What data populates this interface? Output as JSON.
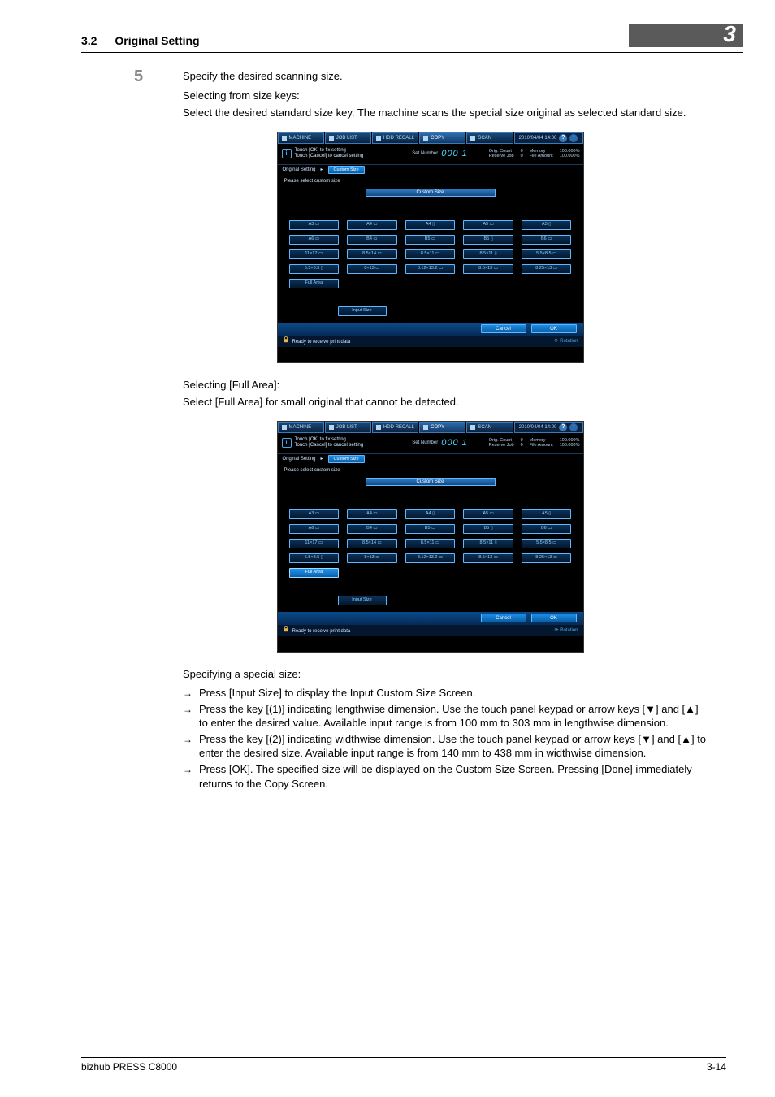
{
  "header": {
    "section_num": "3.2",
    "section_title": "Original Setting",
    "chapter": "3"
  },
  "step": {
    "num": "5",
    "text": "Specify the desired scanning size.",
    "sizekeys_heading": "Selecting from size keys:",
    "sizekeys_body": "Select the desired standard size key. The machine scans the special size original as selected standard size.",
    "fullarea_heading": "Selecting [Full Area]:",
    "fullarea_body": "Select [Full Area] for small original that cannot be detected.",
    "special_heading": "Specifying a special size:",
    "bullets": [
      "Press [Input Size] to display the Input Custom Size Screen.",
      "Press the key [(1)] indicating lengthwise dimension. Use the touch panel keypad or arrow keys [▼] and [▲] to enter the desired value. Available input range is from 100 mm to 303 mm in lengthwise dimension.",
      "Press the key [(2)] indicating widthwise dimension. Use the touch panel keypad or arrow keys [▼] and [▲] to enter the desired size. Available input range is from 140 mm to 438 mm in widthwise di­mension.",
      "Press [OK]. The specified size will be displayed on the Custom Size Screen. Pressing [Done] imme­diately returns to the Copy Screen."
    ]
  },
  "panel": {
    "tabs": [
      "MACHINE",
      "JOB LIST",
      "HDD RECALL",
      "COPY",
      "SCAN"
    ],
    "datetime": "2010/04/04 14:00",
    "help": "?",
    "extra": "↑",
    "info_msg_l1": "Touch [OK] to fix setting",
    "info_msg_l2": "Touch [Cancel] to cancel setting",
    "set_label": "Set Number",
    "set_value": "000 1",
    "orig_label": "Orig. Count",
    "orig_val": "0",
    "reserve_label": "Reserve Job",
    "reserve_val": "0",
    "mem_label": "Memory",
    "mem_val": "100.000%",
    "file_label": "File Amount",
    "file_val": "100.000%",
    "crumb1": "Original Setting",
    "crumb_arrow": "▸",
    "crumb2": "Custom Size",
    "subtitle": "Please select custom size",
    "segment": "Custom Size",
    "rows": [
      [
        "A3 ▭",
        "A4 ▭",
        "A4 ▯",
        "A5 ▭",
        "A5 ▯"
      ],
      [
        "A6 ▭",
        "B4 ▭",
        "B5 ▭",
        "B5 ▯",
        "B6 ▭"
      ],
      [
        "11×17 ▭",
        "8.5×14 ▭",
        "8.5×11 ▭",
        "8.5×11 ▯",
        "5.5×8.5 ▭"
      ],
      [
        "5.5×8.5 ▯",
        "8×13 ▭",
        "8.12×13.2 ▭",
        "8.5×13 ▭",
        "8.25×13 ▭"
      ]
    ],
    "full_area": "Full Area",
    "input_size": "Input Size",
    "cancel": "Cancel",
    "ok": "OK",
    "status": "Ready to receive print data",
    "rotation": "⟳ Rotation"
  },
  "footer": {
    "left": "bizhub PRESS C8000",
    "right": "3-14"
  }
}
